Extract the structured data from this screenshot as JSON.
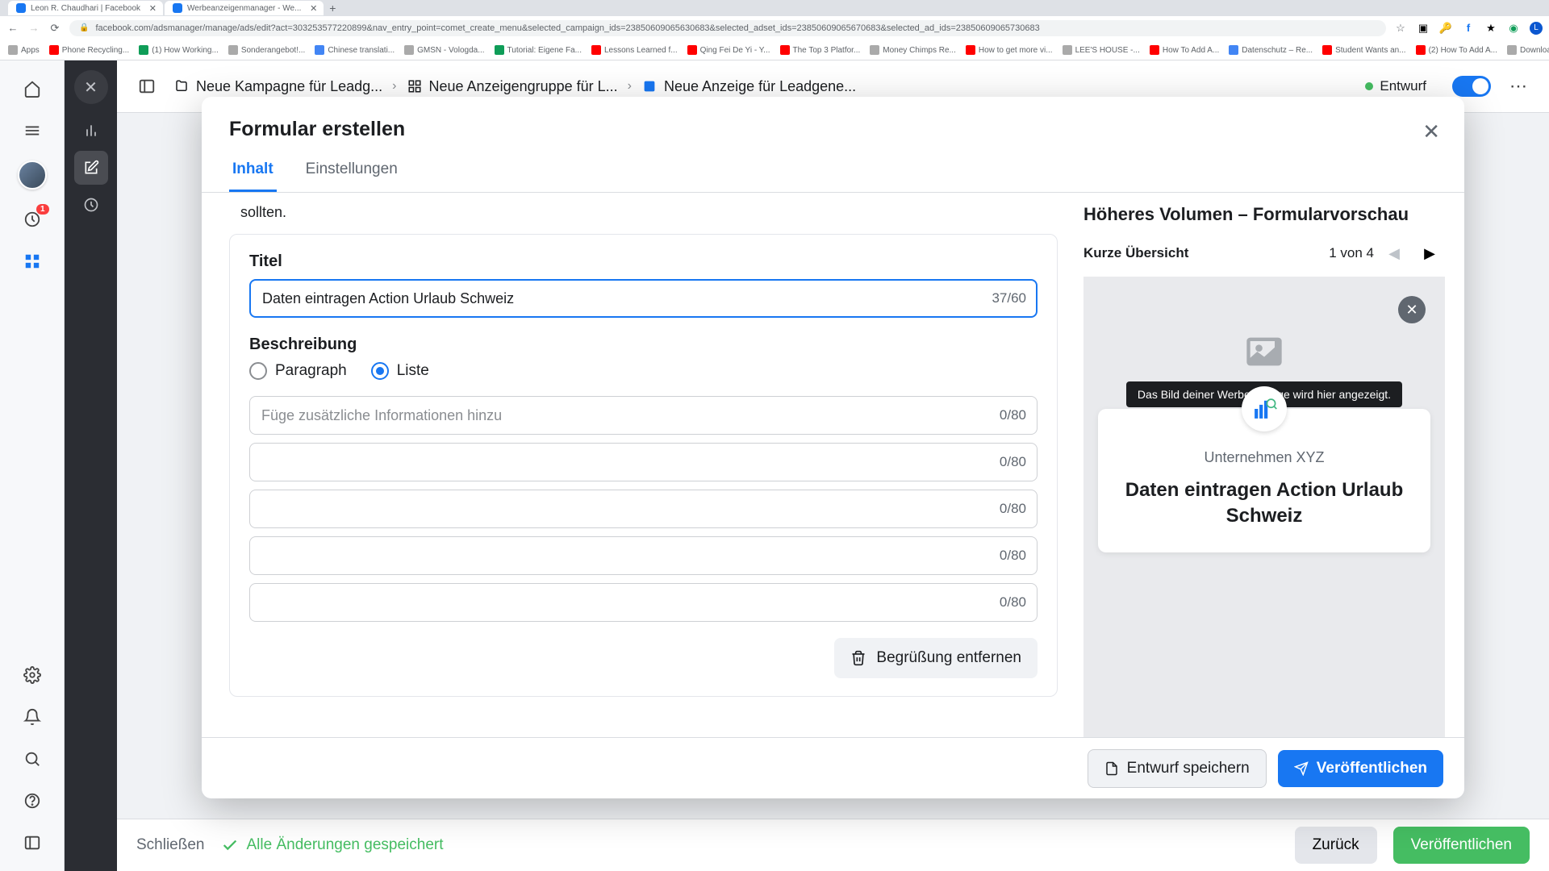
{
  "browser": {
    "tabs": [
      {
        "title": "Leon R. Chaudhari | Facebook"
      },
      {
        "title": "Werbeanzeigenmanager - We..."
      }
    ],
    "url": "facebook.com/adsmanager/manage/ads/edit?act=303253577220899&nav_entry_point=comet_create_menu&selected_campaign_ids=23850609065630683&selected_adset_ids=23850609065670683&selected_ad_ids=23850609065730683",
    "bookmarks": [
      "Apps",
      "Phone Recycling...",
      "(1) How Working...",
      "Sonderangebot!...",
      "Chinese translati...",
      "GMSN - Vologda...",
      "Tutorial: Eigene Fa...",
      "Lessons Learned f...",
      "Qing Fei De Yi - Y...",
      "The Top 3 Platfor...",
      "Money Chimps Re...",
      "How to get more vi...",
      "LEE'S HOUSE -...",
      "How To Add A...",
      "Datenschutz – Re...",
      "Student Wants an...",
      "(2) How To Add A...",
      "Download - Cooki..."
    ]
  },
  "leftRail": {
    "notificationCount": "1"
  },
  "topBar": {
    "crumbs": [
      "Neue Kampagne für Leadg...",
      "Neue Anzeigengruppe für L...",
      "Neue Anzeige für Leadgene..."
    ],
    "status": "Entwurf"
  },
  "bottomBar": {
    "close": "Schließen",
    "saved": "Alle Änderungen gespeichert",
    "back": "Zurück",
    "publish": "Veröffentlichen"
  },
  "modal": {
    "title": "Formular erstellen",
    "tabs": {
      "content": "Inhalt",
      "settings": "Einstellungen"
    },
    "truncated": "sollten.",
    "form": {
      "titleLabel": "Titel",
      "titleValue": "Daten eintragen Action Urlaub Schweiz",
      "titleCount": "37/60",
      "descLabel": "Beschreibung",
      "radioParagraph": "Paragraph",
      "radioList": "Liste",
      "listPlaceholder": "Füge zusätzliche Informationen hinzu",
      "listCount": "0/80",
      "removeBtn": "Begrüßung entfernen"
    },
    "preview": {
      "title": "Höheres Volumen – Formularvorschau",
      "navLabel": "Kurze Übersicht",
      "navCount": "1 von 4",
      "tooltip": "Das Bild deiner Werbeanzeige wird hier angezeigt.",
      "company": "Unternehmen XYZ",
      "headline": "Daten eintragen Action Urlaub Schweiz"
    },
    "footer": {
      "draft": "Entwurf speichern",
      "publish": "Veröffentlichen"
    }
  }
}
